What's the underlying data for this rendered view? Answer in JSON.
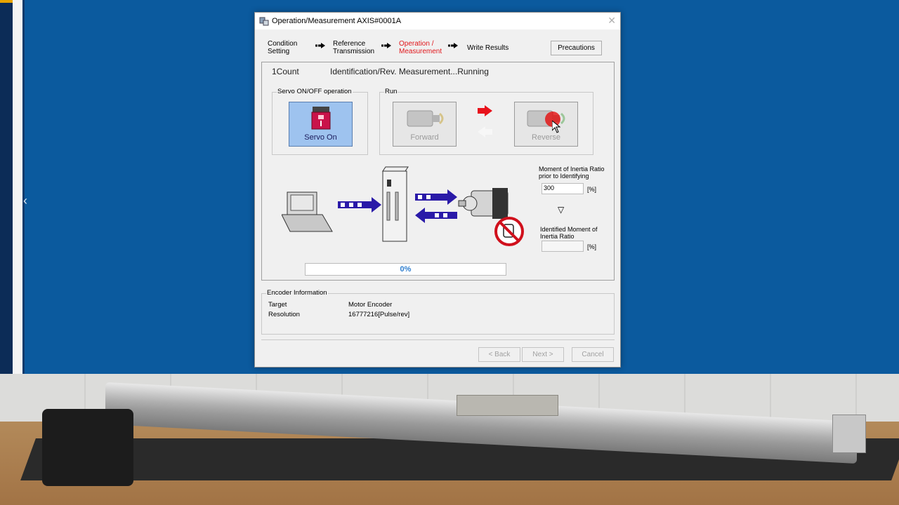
{
  "window": {
    "title": "Operation/Measurement AXIS#0001A",
    "close": "✕"
  },
  "steps": [
    {
      "label_line1": "Condition",
      "label_line2": "Setting"
    },
    {
      "label_line1": "Reference",
      "label_line2": "Transmission"
    },
    {
      "label_line1": "Operation /",
      "label_line2": "Measurement"
    },
    {
      "label_line1": "Write Results",
      "label_line2": ""
    }
  ],
  "active_step_color": "#e0161b",
  "precautions_label": "Precautions",
  "status": {
    "count": "1Count",
    "message": "Identification/Rev. Measurement...Running"
  },
  "servo_group": {
    "title": "Servo ON/OFF operation",
    "button_label": "Servo On"
  },
  "run_group": {
    "title": "Run",
    "forward_label": "Forward",
    "reverse_label": "Reverse"
  },
  "inertia": {
    "prior_label_line1": "Moment of Inertia Ratio",
    "prior_label_line2": "prior to Identifying",
    "prior_value": "300",
    "unit": "[%]",
    "identified_label_line1": "Identified Moment of",
    "identified_label_line2": "Inertia Ratio",
    "identified_value": ""
  },
  "progress": {
    "percent": 0,
    "text": "0%"
  },
  "encoder": {
    "title": "Encoder Information",
    "rows": [
      {
        "key": "Target",
        "value": "Motor Encoder"
      },
      {
        "key": "Resolution",
        "value": "16777216[Pulse/rev]"
      }
    ]
  },
  "nav": {
    "back": "< Back",
    "next": "Next >",
    "cancel": "Cancel"
  },
  "colors": {
    "desktop": "#0b5a9e",
    "diagram_arrow": "#2a1aa8",
    "run_arrow": "#e8121b"
  }
}
